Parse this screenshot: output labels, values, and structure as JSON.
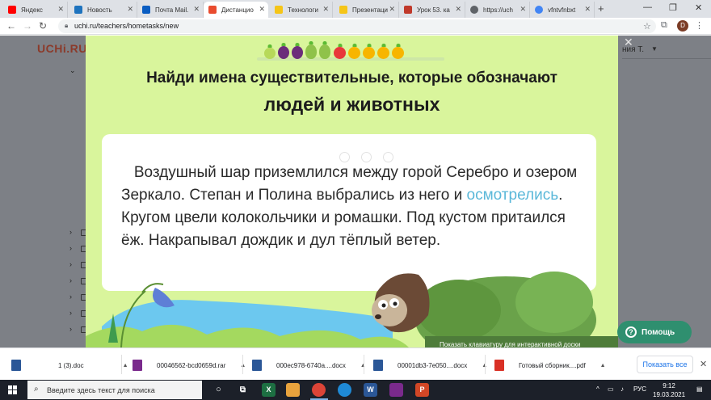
{
  "browser": {
    "tabs": [
      {
        "label": "Яндекс",
        "icon": "yandex-icon",
        "color": "#ff0000"
      },
      {
        "label": "Новость",
        "icon": "news-icon",
        "color": "#1e73be"
      },
      {
        "label": "Почта Mail.",
        "icon": "mail-icon",
        "color": "#0a5dc2"
      },
      {
        "label": "Дистанцио",
        "icon": "uchi-icon",
        "color": "#e94c2f"
      },
      {
        "label": "Технологи",
        "icon": "doc-icon",
        "color": "#f5c518"
      },
      {
        "label": "Презентаци",
        "icon": "slides-icon",
        "color": "#f5c518"
      },
      {
        "label": "Урок 53. ка",
        "icon": "lesson-icon",
        "color": "#c0392b"
      },
      {
        "label": "https://uch",
        "icon": "globe-icon",
        "color": "#5f6368"
      },
      {
        "label": "vfntvfnbxt",
        "icon": "google-icon",
        "color": "#4285f4"
      }
    ],
    "url": "uchi.ru/teachers/hometasks/new",
    "profile_initial": "D"
  },
  "background_page": {
    "logo": "UCHi.RU",
    "user_name": "ния Т."
  },
  "modal": {
    "title_line1": "Найди имена существительные, которые обозначают",
    "title_line2": "людей и животных",
    "story_before": "   Воздушный шар приземлился между горой Серебро и озером Зеркало. Степан и Полина выбрались из него и ",
    "story_highlight": "осмотрелись",
    "story_after": ". Кругом цвели колокольчики и ромашки. Под кустом притаился ёж. Накрапывал дождик и дул тёплый ветер.",
    "keyboard_hint": "Показать клавиатуру для интерактивной доски",
    "highlight_color": "#5bb8d9",
    "background_color": "#d9f59c"
  },
  "help_button": {
    "label": "Помощь"
  },
  "downloads": {
    "items": [
      {
        "name": "1 (3).doc",
        "icon": "word-doc-icon",
        "color": "#2b5797"
      },
      {
        "name": "00046562-bcd0659d.rar",
        "icon": "rar-archive-icon",
        "color": "#7a2a8c"
      },
      {
        "name": "000ec978-6740a....docx",
        "icon": "word-doc-icon",
        "color": "#2b5797"
      },
      {
        "name": "00001db3-7e050....docx",
        "icon": "word-doc-icon",
        "color": "#2b5797"
      },
      {
        "name": "Готовый сборник....pdf",
        "icon": "pdf-icon",
        "color": "#d93025"
      }
    ],
    "show_all": "Показать все"
  },
  "taskbar": {
    "search_placeholder": "Введите здесь текст для поиска",
    "language": "РУС",
    "time": "9:12",
    "date": "19.03.2021"
  }
}
